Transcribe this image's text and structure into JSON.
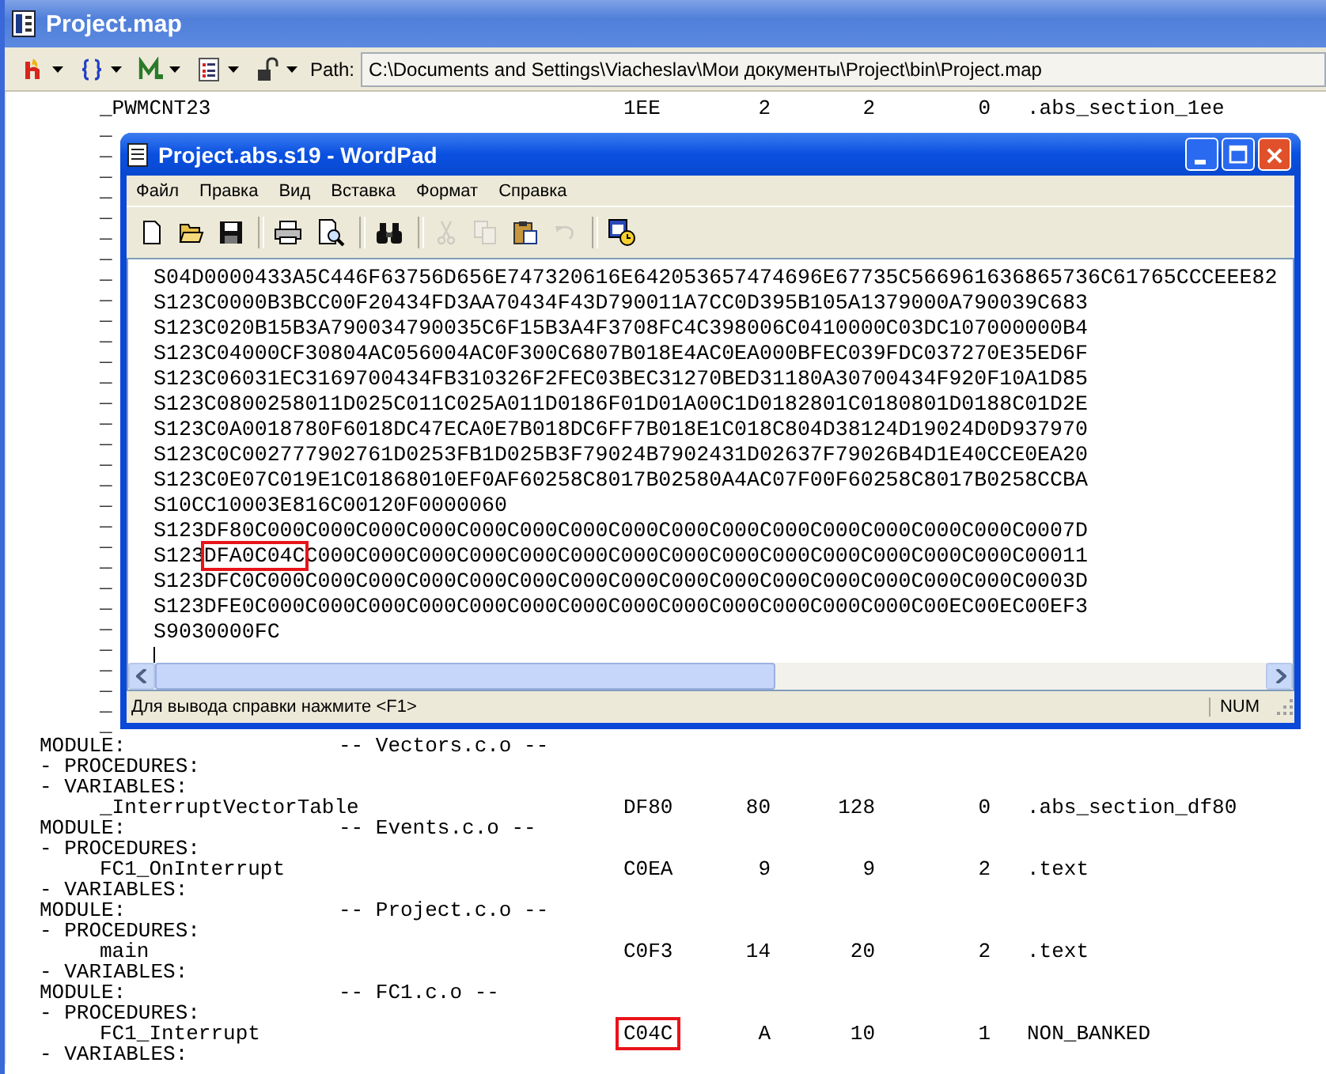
{
  "window": {
    "title": "Project.map"
  },
  "toolbar": {
    "items": [
      {
        "kind": "flame"
      },
      {
        "kind": "braces"
      },
      {
        "kind": "graph"
      },
      {
        "kind": "list"
      },
      {
        "kind": "lock"
      }
    ],
    "path_label": "Path:",
    "path": "C:\\Documents and Settings\\Viacheslav\\Мои документы\\Project\\bin\\Project.map"
  },
  "listing_top": [
    {
      "name": "_PWMCNT23",
      "values": [
        "1EE",
        "2",
        "2",
        "0"
      ],
      "section": ".abs_section_1ee",
      "boxed": false
    }
  ],
  "covered_names": [
    "_",
    "_",
    "_",
    "_",
    "_",
    "_",
    "_",
    "_",
    "_",
    "_",
    "_",
    "_",
    "_",
    "_",
    "_",
    "_",
    "_",
    "_",
    "_",
    "_",
    "_",
    "_",
    "_",
    "_",
    "_",
    "_",
    "_",
    "_",
    "_",
    "_"
  ],
  "listing": [
    {
      "kind": "module",
      "label": "MODULE:",
      "name": "-- Vectors.c.o --"
    },
    {
      "kind": "header",
      "text": "- PROCEDURES:"
    },
    {
      "kind": "header",
      "text": "- VARIABLES:"
    },
    {
      "kind": "symbol",
      "name": "_InterruptVectorTable",
      "values": [
        "DF80",
        "80",
        "128",
        "0"
      ],
      "section": ".abs_section_df80",
      "boxed": false
    },
    {
      "kind": "module",
      "label": "MODULE:",
      "name": "-- Events.c.o --"
    },
    {
      "kind": "header",
      "text": "- PROCEDURES:"
    },
    {
      "kind": "symbol",
      "name": "FC1_OnInterrupt",
      "values": [
        "C0EA",
        "9",
        "9",
        "2"
      ],
      "section": ".text",
      "boxed": false
    },
    {
      "kind": "header",
      "text": "- VARIABLES:"
    },
    {
      "kind": "module",
      "label": "MODULE:",
      "name": "-- Project.c.o --"
    },
    {
      "kind": "header",
      "text": "- PROCEDURES:"
    },
    {
      "kind": "symbol",
      "name": "main",
      "values": [
        "C0F3",
        "14",
        "20",
        "2"
      ],
      "section": ".text",
      "boxed": false
    },
    {
      "kind": "header",
      "text": "- VARIABLES:"
    },
    {
      "kind": "module",
      "label": "MODULE:",
      "name": "-- FC1.c.o --"
    },
    {
      "kind": "header",
      "text": "- PROCEDURES:"
    },
    {
      "kind": "symbol",
      "name": "FC1_Interrupt",
      "values": [
        "C04C",
        "A",
        "10",
        "1"
      ],
      "section": "NON_BANKED",
      "boxed": true
    },
    {
      "kind": "header",
      "text": "- VARIABLES:"
    }
  ],
  "wordpad": {
    "title": "Project.abs.s19 - WordPad",
    "menu": [
      "Файл",
      "Правка",
      "Вид",
      "Вставка",
      "Формат",
      "Справка"
    ],
    "toolbar": [
      {
        "kind": "new",
        "disabled": false
      },
      {
        "kind": "open",
        "disabled": false
      },
      {
        "kind": "save",
        "disabled": false
      },
      {
        "kind": "separator"
      },
      {
        "kind": "print",
        "disabled": false
      },
      {
        "kind": "preview",
        "disabled": false
      },
      {
        "kind": "separator"
      },
      {
        "kind": "find",
        "disabled": false
      },
      {
        "kind": "separator"
      },
      {
        "kind": "cut",
        "disabled": true
      },
      {
        "kind": "copy",
        "disabled": true
      },
      {
        "kind": "paste",
        "disabled": false
      },
      {
        "kind": "undo",
        "disabled": true
      },
      {
        "kind": "separator"
      },
      {
        "kind": "datetime",
        "disabled": false
      }
    ],
    "lines": [
      [
        {
          "text": "S04D0000433A5C446F63756D656E747320616E642053657474696E67735C566961636865736C61765CCCEEE82",
          "boxed": false
        }
      ],
      [
        {
          "text": "S123C0000B3BCC00F20434FD3AA70434F43D790011A7CC0D395B105A1379000A790039C683",
          "boxed": false
        }
      ],
      [
        {
          "text": "S123C020B15B3A790034790035C6F15B3A4F3708FC4C398006C0410000C03DC107000000B4",
          "boxed": false
        }
      ],
      [
        {
          "text": "S123C04000CF30804AC056004AC0F300C6807B018E4AC0EA000BFEC039FDC037270E35ED6F",
          "boxed": false
        }
      ],
      [
        {
          "text": "S123C06031EC3169700434FB310326F2FEC03BEC31270BED31180A30700434F920F10A1D85",
          "boxed": false
        }
      ],
      [
        {
          "text": "S123C0800258011D025C011C025A011D0186F01D01A00C1D0182801C0180801D0188C01D2E",
          "boxed": false
        }
      ],
      [
        {
          "text": "S123C0A0018780F6018DC47ECA0E7B018DC6FF7B018E1C018C804D38124D19024D0D937970",
          "boxed": false
        }
      ],
      [
        {
          "text": "S123C0C002777902761D0253FB1D025B3F79024B7902431D02637F79026B4D1E40CCE0EA20",
          "boxed": false
        }
      ],
      [
        {
          "text": "S123C0E07C019E1C01868010EF0AF60258C8017B02580A4AC07F00F60258C8017B0258CCBA",
          "boxed": false
        }
      ],
      [
        {
          "text": "S10CC10003E816C00120F0000060",
          "boxed": false
        }
      ],
      [
        {
          "text": "S123DF80C000C000C000C000C000C000C000C000C000C000C000C000C000C000C000C0007D",
          "boxed": false
        }
      ],
      [
        {
          "text": "S123",
          "boxed": false
        },
        {
          "text": "DFA0C04C",
          "boxed": true
        },
        {
          "text": "C000C000C000C000C000C000C000C000C000C000C000C000C000C000C00011",
          "boxed": false
        }
      ],
      [
        {
          "text": "S123DFC0C000C000C000C000C000C000C000C000C000C000C000C000C000C000C000C0003D",
          "boxed": false
        }
      ],
      [
        {
          "text": "S123DFE0C000C000C000C000C000C000C000C000C000C000C000C000C000C00EC00EC00EF3",
          "boxed": false
        }
      ],
      [
        {
          "text": "S9030000FC",
          "boxed": false
        }
      ]
    ],
    "status": "Для вывода справки нажмите <F1>",
    "indicator": "NUM"
  }
}
